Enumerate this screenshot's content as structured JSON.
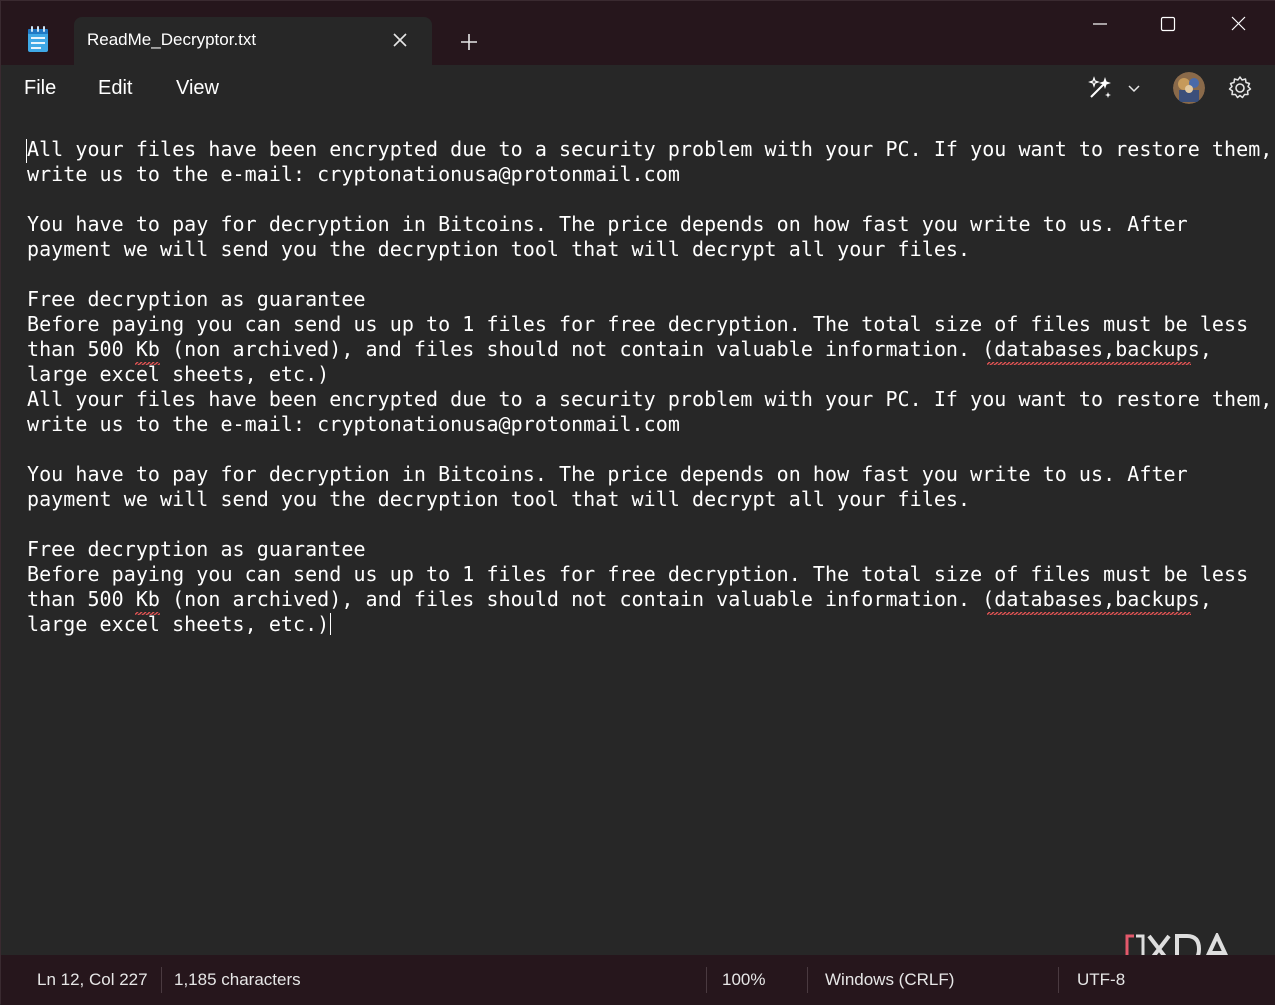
{
  "tab": {
    "title": "ReadMe_Decryptor.txt"
  },
  "menu": {
    "file": "File",
    "edit": "Edit",
    "view": "View"
  },
  "editor": {
    "lines": [
      "All your files have been encrypted due to a security problem with your PC. If you want to restore them,",
      "write us to the e-mail: cryptonationusa@protonmail.com",
      "",
      "You have to pay for decryption in Bitcoins. The price depends on how fast you write to us. After",
      "payment we will send you the decryption tool that will decrypt all your files.",
      "",
      "Free decryption as guarantee",
      "Before paying you can send us up to 1 files for free decryption. The total size of files must be less",
      "than 500 Kb (non archived), and files should not contain valuable information. (databases,backups,",
      "large excel sheets, etc.)",
      "All your files have been encrypted due to a security problem with your PC. If you want to restore them,",
      "write us to the e-mail: cryptonationusa@protonmail.com",
      "",
      "You have to pay for decryption in Bitcoins. The price depends on how fast you write to us. After",
      "payment we will send you the decryption tool that will decrypt all your files.",
      "",
      "Free decryption as guarantee",
      "Before paying you can send us up to 1 files for free decryption. The total size of files must be less",
      "than 500 Kb (non archived), and files should not contain valuable information. (databases,backups,",
      "large excel sheets, etc.)"
    ]
  },
  "status": {
    "position": "Ln 12, Col 227",
    "characters": "1,185 characters",
    "zoom": "100%",
    "line_ending": "Windows (CRLF)",
    "encoding": "UTF-8"
  },
  "watermark": {
    "text": "XDA"
  },
  "colors": {
    "titlebar": "#26161c",
    "editor_bg": "#272727",
    "spellcheck": "#e05353",
    "watermark_accent": "#e3596b"
  },
  "icons": [
    "notepad-icon",
    "close-icon",
    "plus-icon",
    "minimize-icon",
    "maximize-icon",
    "window-close-icon",
    "copilot-icon",
    "chevron-down-icon",
    "gear-icon"
  ]
}
